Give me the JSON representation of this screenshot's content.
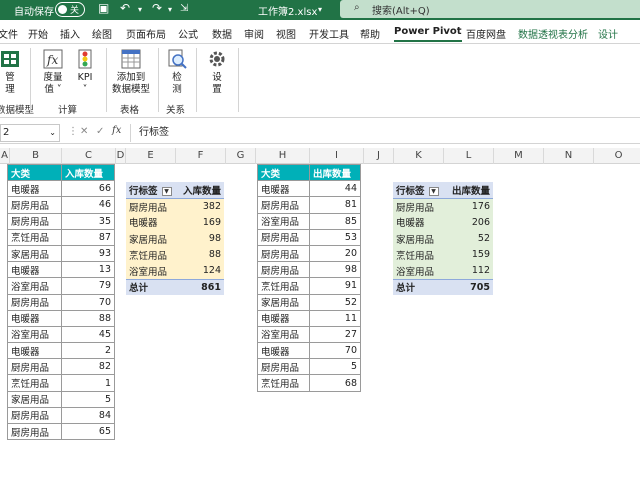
{
  "titlebar": {
    "autosave_label": "自动保存",
    "autosave_state": "关",
    "filename": "工作簿2.xlsx",
    "search_placeholder": "搜索(Alt+Q)"
  },
  "tabs": [
    {
      "label": "文件"
    },
    {
      "label": "开始"
    },
    {
      "label": "插入"
    },
    {
      "label": "绘图"
    },
    {
      "label": "页面布局"
    },
    {
      "label": "公式"
    },
    {
      "label": "数据"
    },
    {
      "label": "审阅"
    },
    {
      "label": "视图"
    },
    {
      "label": "开发工具"
    },
    {
      "label": "帮助"
    },
    {
      "label": "Power Pivot"
    },
    {
      "label": "百度网盘"
    },
    {
      "label": "数据透视表分析"
    },
    {
      "label": "设计"
    }
  ],
  "ribbon": {
    "manage": "管\n理",
    "measures": "度量\n值 ˅",
    "kpi": "KPI\n˅",
    "add_to_model": "添加到\n数据模型",
    "detect": "检\n测",
    "settings": "设\n置",
    "group_data_model": "数据模型",
    "group_calc": "计算",
    "group_table": "表格",
    "group_relation": "关系"
  },
  "formula_bar": {
    "namebox": "2",
    "content": "行标签"
  },
  "columns": [
    "A",
    "B",
    "C",
    "D",
    "E",
    "F",
    "G",
    "H",
    "I",
    "J",
    "K",
    "L",
    "M",
    "N",
    "O"
  ],
  "table_in": {
    "headers": [
      "大类",
      "入库数量"
    ],
    "rows": [
      [
        "电暖器",
        "66"
      ],
      [
        "厨房用品",
        "46"
      ],
      [
        "厨房用品",
        "35"
      ],
      [
        "烹饪用品",
        "87"
      ],
      [
        "家居用品",
        "93"
      ],
      [
        "电暖器",
        "13"
      ],
      [
        "浴室用品",
        "79"
      ],
      [
        "厨房用品",
        "70"
      ],
      [
        "电暖器",
        "88"
      ],
      [
        "浴室用品",
        "45"
      ],
      [
        "电暖器",
        "2"
      ],
      [
        "厨房用品",
        "82"
      ],
      [
        "烹饪用品",
        "1"
      ],
      [
        "家居用品",
        "5"
      ],
      [
        "厨房用品",
        "84"
      ],
      [
        "厨房用品",
        "65"
      ]
    ]
  },
  "pivot_in": {
    "headers": [
      "行标签",
      "入库数量"
    ],
    "rows": [
      [
        "厨房用品",
        "382"
      ],
      [
        "电暖器",
        "169"
      ],
      [
        "家居用品",
        "98"
      ],
      [
        "烹饪用品",
        "88"
      ],
      [
        "浴室用品",
        "124"
      ]
    ],
    "total": [
      "总计",
      "861"
    ]
  },
  "table_out": {
    "headers": [
      "大类",
      "出库数量"
    ],
    "rows": [
      [
        "电暖器",
        "44"
      ],
      [
        "厨房用品",
        "81"
      ],
      [
        "浴室用品",
        "85"
      ],
      [
        "厨房用品",
        "53"
      ],
      [
        "厨房用品",
        "20"
      ],
      [
        "厨房用品",
        "98"
      ],
      [
        "烹饪用品",
        "91"
      ],
      [
        "家居用品",
        "52"
      ],
      [
        "电暖器",
        "11"
      ],
      [
        "浴室用品",
        "27"
      ],
      [
        "电暖器",
        "70"
      ],
      [
        "厨房用品",
        "5"
      ],
      [
        "烹饪用品",
        "68"
      ]
    ]
  },
  "pivot_out": {
    "headers": [
      "行标签",
      "出库数量"
    ],
    "rows": [
      [
        "厨房用品",
        "176"
      ],
      [
        "电暖器",
        "206"
      ],
      [
        "家居用品",
        "52"
      ],
      [
        "烹饪用品",
        "159"
      ],
      [
        "浴室用品",
        "112"
      ]
    ],
    "total": [
      "总计",
      "705"
    ]
  }
}
